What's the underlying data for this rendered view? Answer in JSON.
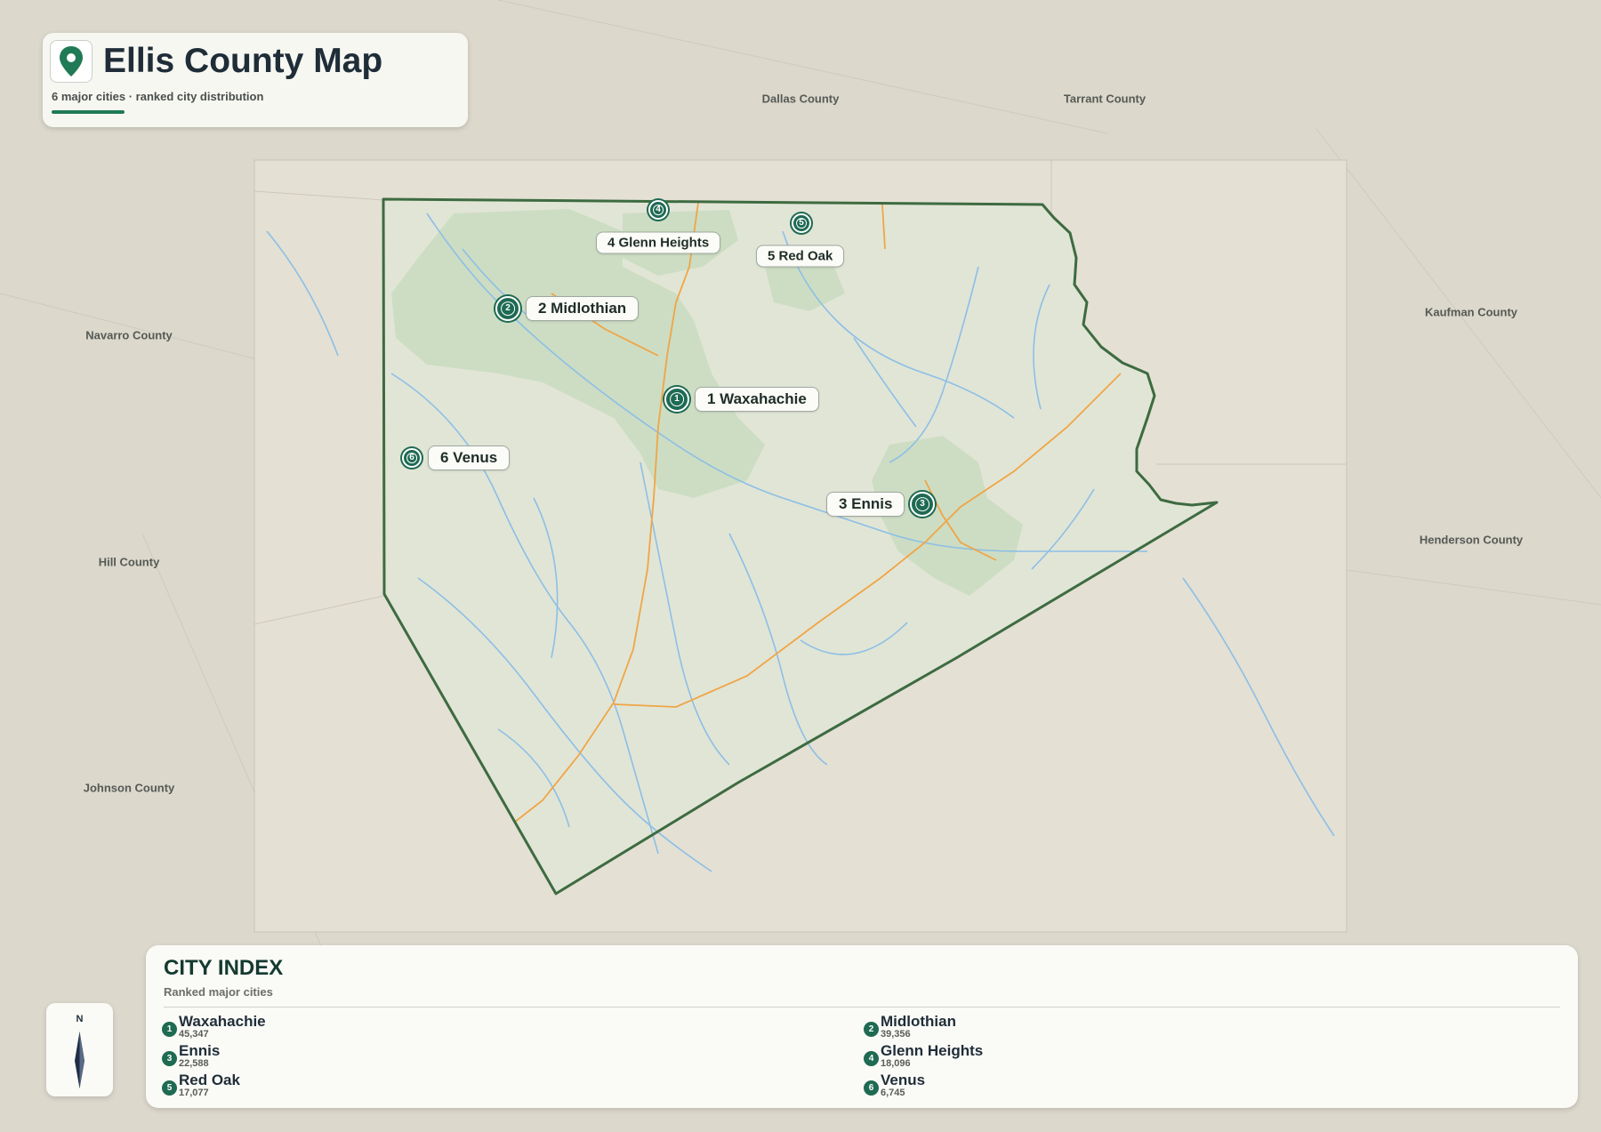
{
  "header": {
    "title": "Ellis County Map",
    "subtitle": "6 major cities · ranked city distribution"
  },
  "neighbors": [
    {
      "name": "Dallas County"
    },
    {
      "name": "Tarrant County"
    },
    {
      "name": "Navarro County"
    },
    {
      "name": "Kaufman County"
    },
    {
      "name": "Hill County"
    },
    {
      "name": "Henderson County"
    },
    {
      "name": "Johnson County"
    }
  ],
  "cities": [
    {
      "rank": "1",
      "name": "Waxahachie",
      "label": "1 Waxahachie",
      "population": "45,347"
    },
    {
      "rank": "2",
      "name": "Midlothian",
      "label": "2 Midlothian",
      "population": "39,356"
    },
    {
      "rank": "3",
      "name": "Ennis",
      "label": "3 Ennis",
      "population": "22,588"
    },
    {
      "rank": "4",
      "name": "Glenn Heights",
      "label": "4 Glenn Heights",
      "population": "18,096"
    },
    {
      "rank": "5",
      "name": "Red Oak",
      "label": "5 Red Oak",
      "population": "17,077"
    },
    {
      "rank": "6",
      "name": "Venus",
      "label": "6 Venus",
      "population": "6,745"
    }
  ],
  "index": {
    "title": "CITY INDEX",
    "subtitle": "Ranked major cities"
  },
  "compass": {
    "north_label": "N"
  },
  "colors": {
    "accent": "#1e6a52",
    "boundary": "#3d6b40",
    "water": "#7fb6e0",
    "road": "#f0a545",
    "urban": "#c9dcc0"
  }
}
